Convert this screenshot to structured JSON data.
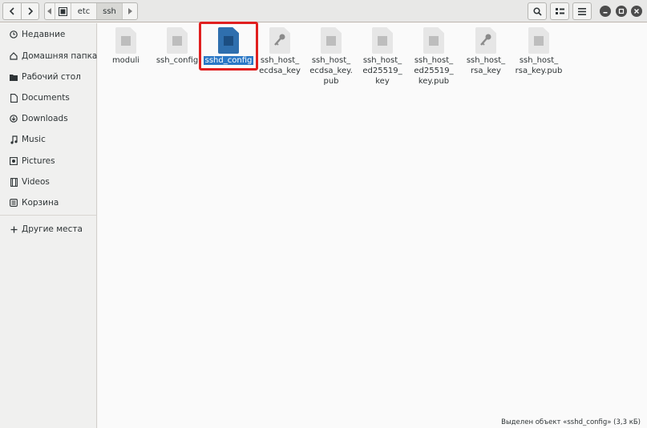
{
  "header": {
    "path": [
      "etc",
      "ssh"
    ],
    "active_segment": "ssh"
  },
  "sidebar": {
    "items": [
      {
        "label": "Недавние",
        "icon": "clock-icon"
      },
      {
        "label": "Домашняя папка",
        "icon": "home-icon"
      },
      {
        "label": "Рабочий стол",
        "icon": "folder-icon"
      },
      {
        "label": "Documents",
        "icon": "document-icon"
      },
      {
        "label": "Downloads",
        "icon": "download-icon"
      },
      {
        "label": "Music",
        "icon": "music-icon"
      },
      {
        "label": "Pictures",
        "icon": "camera-icon"
      },
      {
        "label": "Videos",
        "icon": "film-icon"
      },
      {
        "label": "Корзина",
        "icon": "trash-icon"
      },
      {
        "label": "Другие места",
        "icon": "plus-icon"
      }
    ]
  },
  "files": [
    {
      "name": "moduli",
      "type": "text"
    },
    {
      "name": "ssh_config",
      "type": "text"
    },
    {
      "name": "sshd_config",
      "type": "text",
      "selected": true
    },
    {
      "name": "ssh_host_\necdsa_key",
      "type": "key"
    },
    {
      "name": "ssh_host_\necdsa_key.\npub",
      "type": "text"
    },
    {
      "name": "ssh_host_\ned25519_\nkey",
      "type": "text"
    },
    {
      "name": "ssh_host_\ned25519_\nkey.pub",
      "type": "text"
    },
    {
      "name": "ssh_host_\nrsa_key",
      "type": "key"
    },
    {
      "name": "ssh_host_\nrsa_key.pub",
      "type": "text"
    }
  ],
  "status": "Выделен объект «sshd_config» (3,3 кБ)",
  "colors": {
    "selection": "#2b78c6",
    "highlight_box": "#e01f1f"
  }
}
